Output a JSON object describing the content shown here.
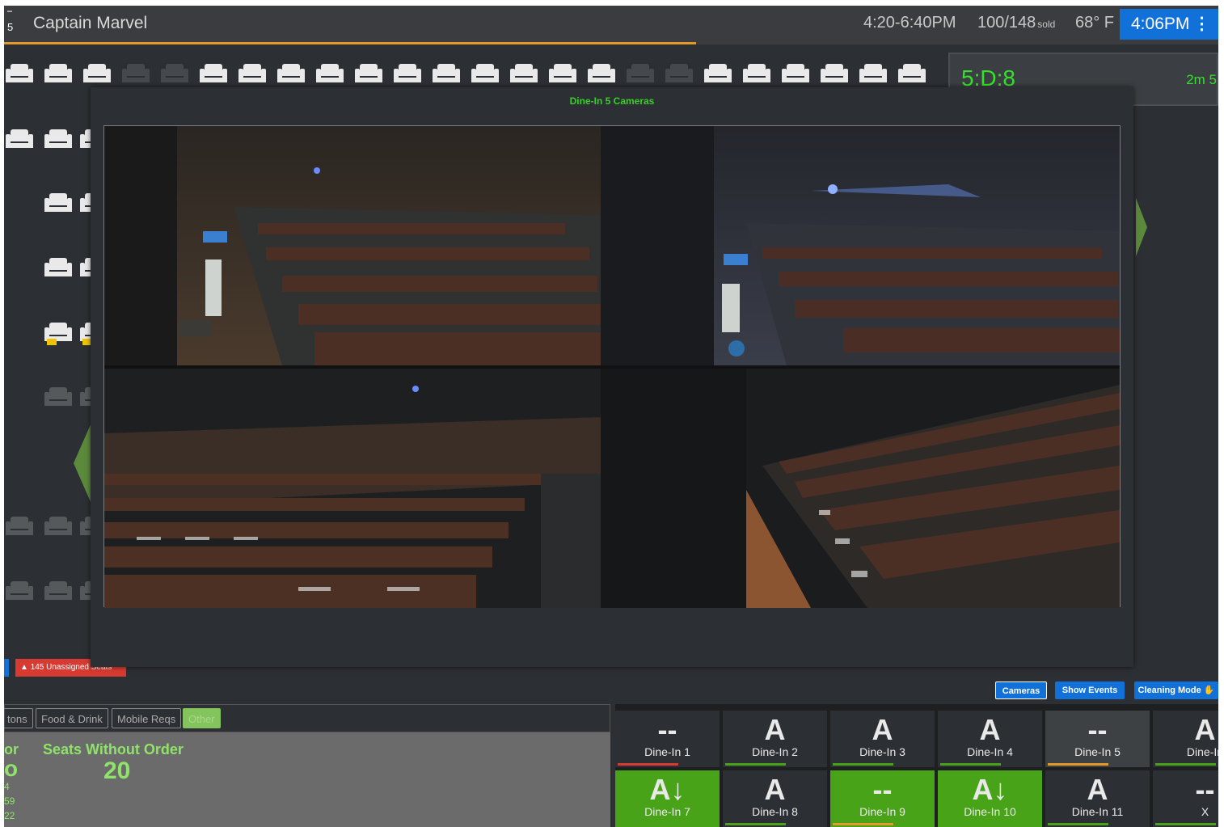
{
  "header": {
    "screen_number": "5",
    "movie_title": "Captain Marvel",
    "showtime": "4:20-6:40PM",
    "sold_count": "100/148",
    "sold_label": "sold",
    "temperature": "68° F",
    "clock": "4:06PM",
    "progress_percent": 57
  },
  "side_panel": {
    "seat_code": "5:D:8",
    "timer": "2m 5"
  },
  "alerts": {
    "unassigned_seats": "145 Unassigned Seats"
  },
  "modal": {
    "title": "Dine-In 5 Cameras"
  },
  "actions": {
    "cameras": "Cameras",
    "show_events": "Show Events",
    "cleaning_mode": "Cleaning Mode"
  },
  "tabs": [
    {
      "label": "tons",
      "active": false
    },
    {
      "label": "Food & Drink",
      "active": false
    },
    {
      "label": "Mobile Reqs",
      "active": false
    },
    {
      "label": "Other",
      "active": true
    }
  ],
  "stats": {
    "left_label": "or",
    "left_value": "o",
    "left_sub": [
      "4",
      "59",
      "22"
    ],
    "seats_without_order_label": "Seats Without Order",
    "seats_without_order_value": "20"
  },
  "theaters": [
    {
      "label": "Dine-In 1",
      "status": "--",
      "bar": "#d63a31",
      "bg": "dark"
    },
    {
      "label": "Dine-In 2",
      "status": "A",
      "bar": "#49a318",
      "bg": "dark"
    },
    {
      "label": "Dine-In 3",
      "status": "A",
      "bar": "#49a318",
      "bg": "dark"
    },
    {
      "label": "Dine-In 4",
      "status": "A",
      "bar": "#49a318",
      "bg": "dark"
    },
    {
      "label": "Dine-In 5",
      "status": "--",
      "bar": "#e49a2a",
      "bg": "grey"
    },
    {
      "label": "Dine-In",
      "status": "A",
      "bar": "#49a318",
      "bg": "dark"
    },
    {
      "label": "Dine-In 7",
      "status": "A↓",
      "bar": "#49a318",
      "bg": "green"
    },
    {
      "label": "Dine-In 8",
      "status": "A",
      "bar": "#49a318",
      "bg": "dark"
    },
    {
      "label": "Dine-In 9",
      "status": "--",
      "bar": "#e49a2a",
      "bg": "green"
    },
    {
      "label": "Dine-In 10",
      "status": "A↓",
      "bar": "#49a318",
      "bg": "green"
    },
    {
      "label": "Dine-In 11",
      "status": "A",
      "bar": "#49a318",
      "bg": "dark"
    },
    {
      "label": "X",
      "status": "--",
      "bar": "#49a318",
      "bg": "dark"
    }
  ]
}
